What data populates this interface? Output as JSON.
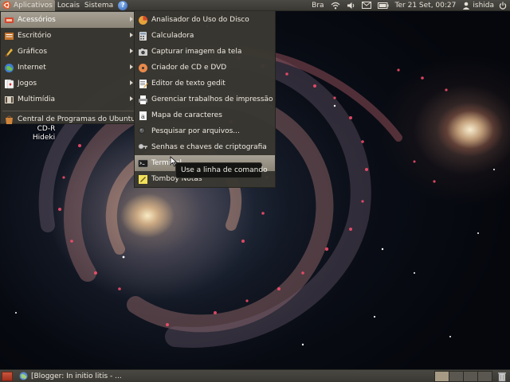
{
  "top_panel": {
    "menus": [
      "Aplicativos",
      "Locais",
      "Sistema"
    ],
    "keyboard_layout": "Bra",
    "clock": "Ter 21 Set, 00:27",
    "user": "ishida"
  },
  "apps_menu": {
    "items": [
      {
        "label": "Acessórios",
        "icon": "accessories-icon",
        "has_submenu": true,
        "selected": true
      },
      {
        "label": "Escritório",
        "icon": "office-icon",
        "has_submenu": true
      },
      {
        "label": "Gráficos",
        "icon": "graphics-icon",
        "has_submenu": true
      },
      {
        "label": "Internet",
        "icon": "internet-icon",
        "has_submenu": true
      },
      {
        "label": "Jogos",
        "icon": "games-icon",
        "has_submenu": true
      },
      {
        "label": "Multimídia",
        "icon": "multimedia-icon",
        "has_submenu": true
      }
    ],
    "extra": {
      "label": "Central de Programas do Ubuntu",
      "icon": "software-center-icon"
    }
  },
  "accessories_menu": {
    "items": [
      {
        "label": "Analisador do Uso do Disco",
        "icon": "disk-usage-icon"
      },
      {
        "label": "Calculadora",
        "icon": "calculator-icon"
      },
      {
        "label": "Capturar imagem da tela",
        "icon": "screenshot-icon"
      },
      {
        "label": "Criador de CD e DVD",
        "icon": "cd-burner-icon"
      },
      {
        "label": "Editor de texto gedit",
        "icon": "text-editor-icon"
      },
      {
        "label": "Gerenciar trabalhos de impressão",
        "icon": "printer-icon"
      },
      {
        "label": "Mapa de caracteres",
        "icon": "character-map-icon"
      },
      {
        "label": "Pesquisar por arquivos...",
        "icon": "search-files-icon"
      },
      {
        "label": "Senhas e chaves de criptografia",
        "icon": "keys-icon"
      },
      {
        "label": "Terminal",
        "icon": "terminal-icon",
        "selected": true
      },
      {
        "label": "Tomboy Notas",
        "icon": "notes-icon"
      }
    ]
  },
  "tooltip": "Use a linha de comando",
  "desktop_icon": {
    "label": "CD-R",
    "label2": "Hideki"
  },
  "taskbar": {
    "window_title": "[Blogger: In initio litis - ..."
  },
  "colors": {
    "panel": "#3f3d38",
    "menu": "#3a3832",
    "selection": "#9a9386"
  }
}
